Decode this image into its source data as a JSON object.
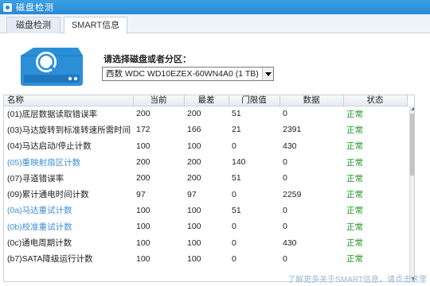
{
  "window": {
    "title": "磁盘检测"
  },
  "tabs": [
    {
      "label": "磁盘检测",
      "active": false
    },
    {
      "label": "SMART信息",
      "active": true
    }
  ],
  "disk_select": {
    "label": "请选择磁盘或者分区：",
    "value": "西数 WDC WD10EZEX-60WN4A0  (1 TB)"
  },
  "table": {
    "columns": [
      "名称",
      "当前",
      "最差",
      "门限值",
      "数据",
      "状态"
    ],
    "rows": [
      {
        "name": "(01)底层数据读取错误率",
        "current": "200",
        "worst": "200",
        "threshold": "51",
        "data": "0",
        "status": "正常",
        "link": false
      },
      {
        "name": "(03)马达旋转到标准转速所需时间",
        "current": "172",
        "worst": "166",
        "threshold": "21",
        "data": "2391",
        "status": "正常",
        "link": false
      },
      {
        "name": "(04)马达启动/停止计数",
        "current": "100",
        "worst": "100",
        "threshold": "0",
        "data": "430",
        "status": "正常",
        "link": false
      },
      {
        "name": "(05)重映射扇区计数",
        "current": "200",
        "worst": "200",
        "threshold": "140",
        "data": "0",
        "status": "正常",
        "link": true
      },
      {
        "name": "(07)寻道错误率",
        "current": "200",
        "worst": "200",
        "threshold": "51",
        "data": "0",
        "status": "正常",
        "link": false
      },
      {
        "name": "(09)累计通电时间计数",
        "current": "97",
        "worst": "97",
        "threshold": "0",
        "data": "2259",
        "status": "正常",
        "link": false
      },
      {
        "name": "(0a)马达重试计数",
        "current": "100",
        "worst": "100",
        "threshold": "51",
        "data": "0",
        "status": "正常",
        "link": true
      },
      {
        "name": "(0b)校准重试计数",
        "current": "100",
        "worst": "100",
        "threshold": "0",
        "data": "0",
        "status": "正常",
        "link": true
      },
      {
        "name": "(0c)通电周期计数",
        "current": "100",
        "worst": "100",
        "threshold": "0",
        "data": "430",
        "status": "正常",
        "link": false
      },
      {
        "name": "(b7)SATA降级运行计数",
        "current": "100",
        "worst": "100",
        "threshold": "0",
        "data": "0",
        "status": "正常",
        "link": false
      }
    ]
  },
  "footer": {
    "link_text": "了解更多关于SMART信息，请点击这里"
  },
  "colors": {
    "titlebar": "#2a8ad4",
    "status_ok": "#1e9a1e",
    "link": "#3d8fd6",
    "disk_icon": "#2b8fd8"
  },
  "icons": {
    "app": "app-icon",
    "disk": "hard-disk-search-icon"
  }
}
